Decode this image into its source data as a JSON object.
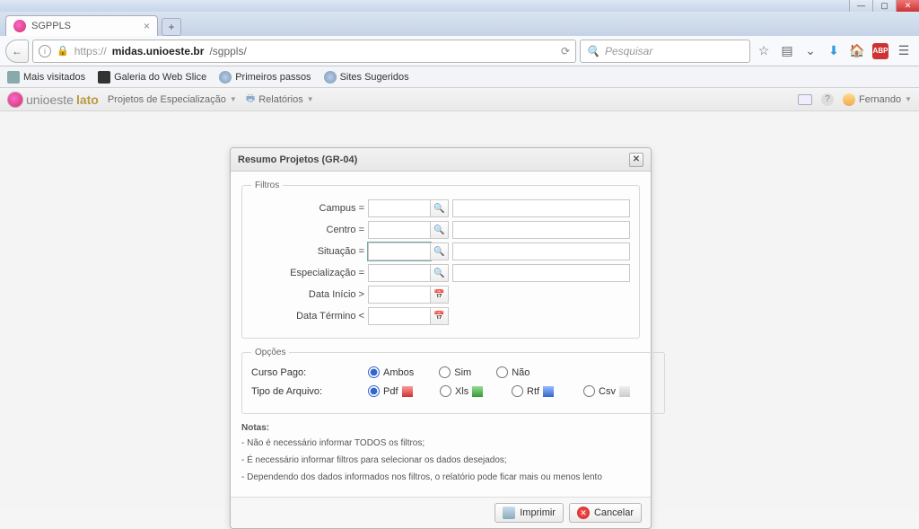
{
  "browser": {
    "tab_title": "SGPPLS",
    "url_proto": "https://",
    "url_host": "midas.unioeste.br",
    "url_path": "/sgppls/",
    "search_placeholder": "Pesquisar",
    "bookmarks": {
      "b1": "Mais visitados",
      "b2": "Galeria do Web Slice",
      "b3": "Primeiros passos",
      "b4": "Sites Sugeridos"
    }
  },
  "app": {
    "logo1": "unioeste",
    "logo2": "lato",
    "menu1": "Projetos de Especialização",
    "menu2": "Relatórios",
    "user": "Fernando"
  },
  "modal": {
    "title": "Resumo Projetos (GR-04)",
    "legend_filtros": "Filtros",
    "legend_opcoes": "Opções",
    "lbl_campus": "Campus =",
    "lbl_centro": "Centro =",
    "lbl_situacao": "Situação =",
    "lbl_especializacao": "Especialização =",
    "lbl_data_inicio": "Data Início >",
    "lbl_data_termino": "Data Término <",
    "lbl_curso_pago": "Curso Pago:",
    "lbl_tipo_arquivo": "Tipo de Arquivo:",
    "opt_ambos": "Ambos",
    "opt_sim": "Sim",
    "opt_nao": "Não",
    "opt_pdf": "Pdf",
    "opt_xls": "Xls",
    "opt_rtf": "Rtf",
    "opt_csv": "Csv",
    "notes_title": "Notas:",
    "note1": "- Não é necessário informar TODOS os filtros;",
    "note2": "- É necessário informar filtros para selecionar os dados desejados;",
    "note3": "- Dependendo dos dados informados nos filtros, o relatório pode ficar mais ou menos lento",
    "btn_imprimir": "Imprimir",
    "btn_cancelar": "Cancelar",
    "selected_curso_pago": "ambos",
    "selected_tipo_arquivo": "pdf"
  }
}
